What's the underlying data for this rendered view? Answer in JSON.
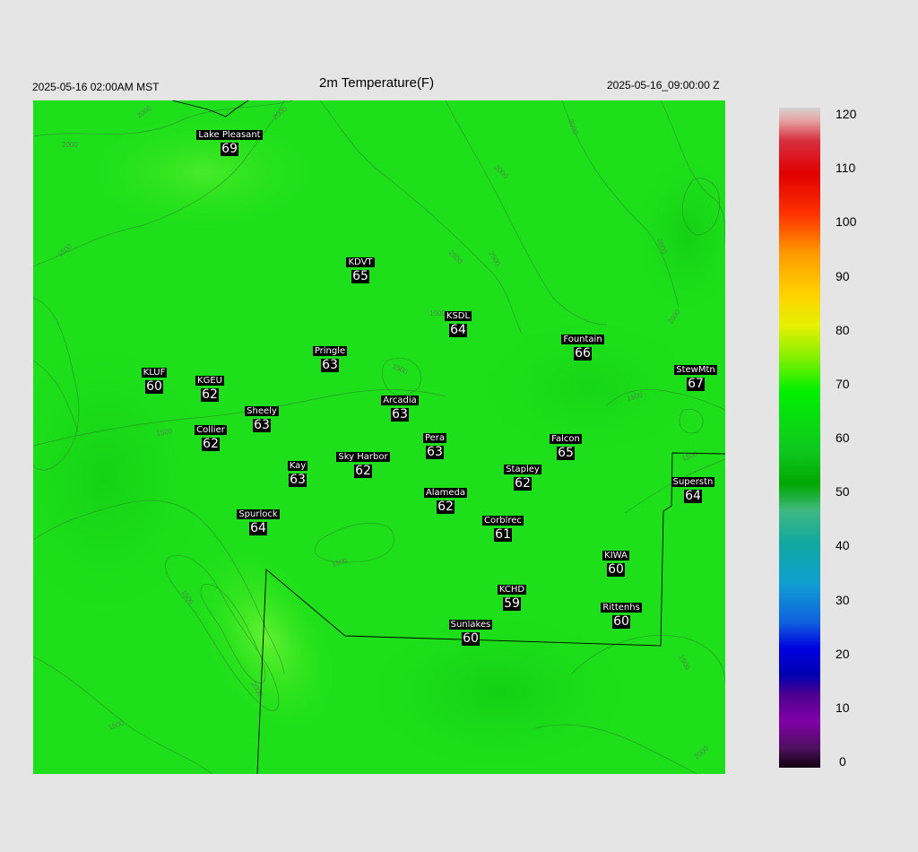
{
  "header": {
    "local_time": "2025-05-16 02:00AM MST",
    "title": "2m Temperature(F)",
    "utc_time": "2025-05-16_09:00:00 Z"
  },
  "colorbar": {
    "min": 0,
    "max": 120,
    "ticks": [
      "120",
      "110",
      "100",
      "90",
      "80",
      "70",
      "60",
      "50",
      "40",
      "30",
      "20",
      "10",
      "0"
    ]
  },
  "contours": [
    "2000",
    "2000",
    "2000",
    "2000",
    "2000",
    "1500",
    "2500",
    "2500",
    "2000",
    "2000",
    "1500",
    "1500",
    "1500",
    "1500",
    "1500",
    "1500",
    "1500",
    "1500",
    "2000",
    "1500",
    "2000"
  ],
  "stations": [
    {
      "name": "Lake Pleasant",
      "temp": "69"
    },
    {
      "name": "KDVT",
      "temp": "65"
    },
    {
      "name": "KSDL",
      "temp": "64"
    },
    {
      "name": "Fountain",
      "temp": "66"
    },
    {
      "name": "StewMtn",
      "temp": "67"
    },
    {
      "name": "Pringle",
      "temp": "63"
    },
    {
      "name": "KLUF",
      "temp": "60"
    },
    {
      "name": "KGEU",
      "temp": "62"
    },
    {
      "name": "Arcadia",
      "temp": "63"
    },
    {
      "name": "Sheely",
      "temp": "63"
    },
    {
      "name": "Collier",
      "temp": "62"
    },
    {
      "name": "Pera",
      "temp": "63"
    },
    {
      "name": "Falcon",
      "temp": "65"
    },
    {
      "name": "Sky Harbor",
      "temp": "62"
    },
    {
      "name": "Kay",
      "temp": "63"
    },
    {
      "name": "Stapley",
      "temp": "62"
    },
    {
      "name": "Superstn",
      "temp": "64"
    },
    {
      "name": "Alameda",
      "temp": "62"
    },
    {
      "name": "Spurlock",
      "temp": "64"
    },
    {
      "name": "Corblrec",
      "temp": "61"
    },
    {
      "name": "KIWA",
      "temp": "60"
    },
    {
      "name": "KCHD",
      "temp": "59"
    },
    {
      "name": "Rittenhs",
      "temp": "60"
    },
    {
      "name": "Sunlakes",
      "temp": "60"
    }
  ]
}
